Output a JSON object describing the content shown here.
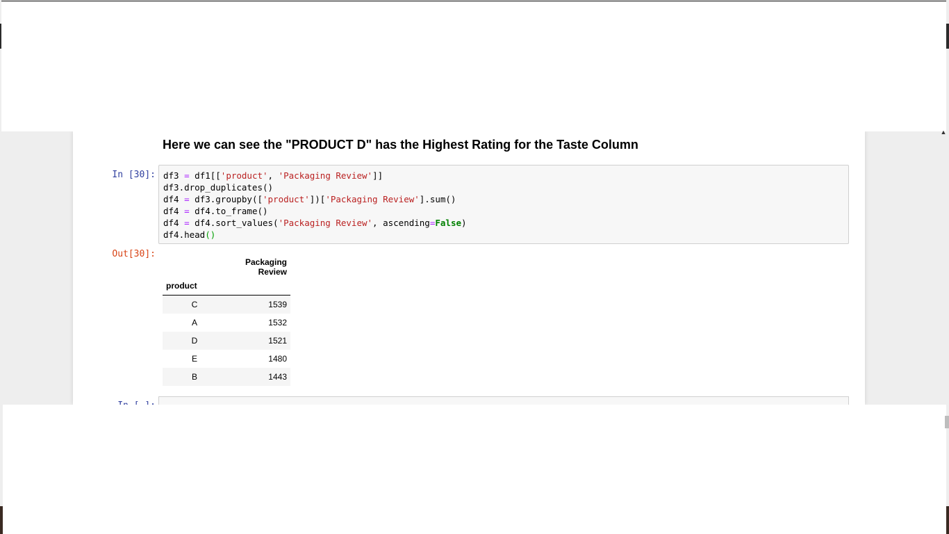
{
  "markdown": {
    "heading": "Here we can see the \"PRODUCT D\" has the Highest Rating for the Taste Column"
  },
  "cell_30": {
    "in_prompt": "In [30]:",
    "out_prompt": "Out[30]:",
    "code": {
      "line1": [
        "df3 ",
        "=",
        " df1[[",
        "'product'",
        ", ",
        "'Packaging Review'",
        "]]"
      ],
      "line2": "df3.drop_duplicates()",
      "line3": [
        "df4 ",
        "=",
        " df3.groupby([",
        "'product'",
        "])[",
        "'Packaging Review'",
        "].sum()"
      ],
      "line4": [
        "df4 ",
        "=",
        " df4.to_frame()"
      ],
      "line5": [
        "df4 ",
        "=",
        " df4.sort_values(",
        "'Packaging Review'",
        ", ascending",
        "=",
        "False",
        ")"
      ],
      "line6": [
        "df4.head",
        "()"
      ]
    },
    "output_table": {
      "column": "Packaging Review",
      "index_name": "product",
      "rows": [
        {
          "index": "C",
          "value": "1539"
        },
        {
          "index": "A",
          "value": "1532"
        },
        {
          "index": "D",
          "value": "1521"
        },
        {
          "index": "E",
          "value": "1480"
        },
        {
          "index": "B",
          "value": "1443"
        }
      ]
    }
  },
  "next_cell": {
    "in_prompt": "In [ ]:"
  }
}
